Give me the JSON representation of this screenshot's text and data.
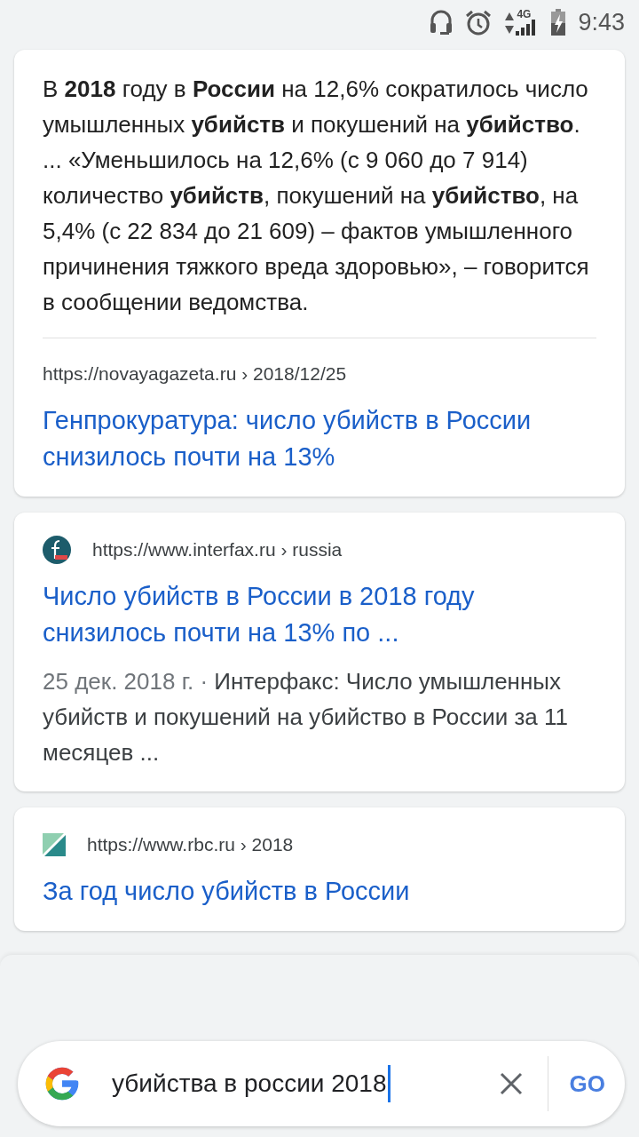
{
  "status_bar": {
    "network": "4G",
    "time": "9:43"
  },
  "results": [
    {
      "kind": "featured",
      "snippet": "В **2018** году в **России** на 12,6% сократилось число умышленных **убийств** и покушений на **убийство**. ... «Уменьшилось на 12,6% (с 9 060 до 7 914) количество **убийств**, покушений на **убийство**, на 5,4% (с 22 834 до 21 609) – фактов умышленного причинения тяжкого вреда здоровью», – говорится в сообщении ведомства.",
      "url": "https://novayagazeta.ru › 2018/12/25",
      "title": "Генпрокуратура: число убийств в России снизилось почти на 13%"
    },
    {
      "kind": "result",
      "url": "https://www.interfax.ru › russia",
      "title": "Число убийств в России в 2018 году снизилось почти на 13% по ...",
      "date": "25 дек. 2018 г. ·",
      "snippet": "Интерфакс: Число умышленных убийств и покушений на убийство в России за 11 месяцев ..."
    },
    {
      "kind": "result",
      "url": "https://www.rbc.ru › 2018",
      "title": "За год число убийств в России"
    }
  ],
  "search": {
    "value": "убийства в россии 2018",
    "go": "GO"
  }
}
